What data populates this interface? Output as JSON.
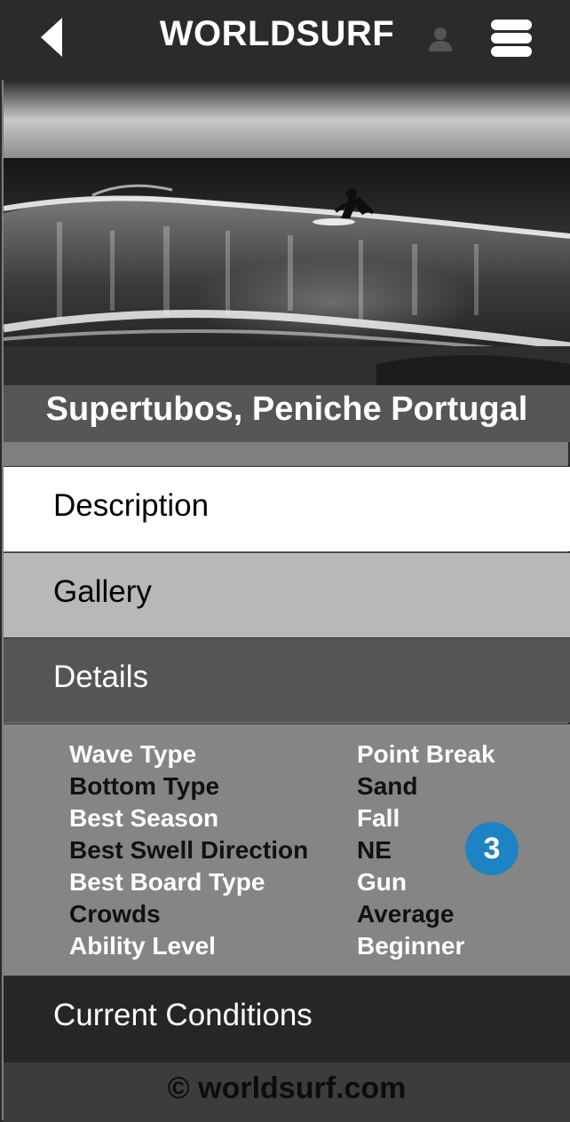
{
  "header": {
    "title": "WORLDSURF",
    "back_icon": "back-arrow-icon",
    "user_icon": "user-icon",
    "menu_icon": "hamburger-menu-icon"
  },
  "hero": {
    "image": "black-and-white photo of surfer riding a wave",
    "spot_name": "Supertubos, Peniche Portugal"
  },
  "sections": {
    "description": "Description",
    "gallery": "Gallery",
    "details": "Details",
    "conditions": "Current Conditions"
  },
  "details": {
    "rows": [
      {
        "key": "Wave Type",
        "value": "Point Break"
      },
      {
        "key": "Bottom Type",
        "value": "Sand"
      },
      {
        "key": "Best Season",
        "value": "Fall"
      },
      {
        "key": "Best Swell Direction",
        "value": "NE"
      },
      {
        "key": "Best Board Type",
        "value": "Gun"
      },
      {
        "key": "Crowds",
        "value": "Average"
      },
      {
        "key": "Ability Level",
        "value": "Beginner"
      }
    ],
    "badge": "3"
  },
  "footer": {
    "text": "© worldsurf.com"
  },
  "colors": {
    "header_bg": "#2b2b2b",
    "badge": "#1d83c4",
    "details_bg": "#555555",
    "conditions_bg": "#262626"
  }
}
